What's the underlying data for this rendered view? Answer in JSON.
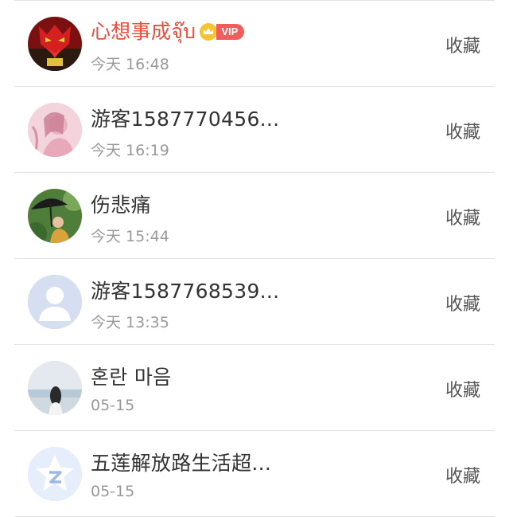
{
  "items": [
    {
      "name": "心想事成จุ๊บ",
      "time": "今天 16:48",
      "action": "收藏",
      "vip": true,
      "vip_label": "VIP",
      "avatar": "red-mask"
    },
    {
      "name": "游客1587770456...",
      "time": "今天 16:19",
      "action": "收藏",
      "vip": false,
      "avatar": "pink-girl"
    },
    {
      "name": "伤悲痛",
      "time": "今天 15:44",
      "action": "收藏",
      "vip": false,
      "avatar": "umbrella-girl"
    },
    {
      "name": "游客1587768539...",
      "time": "今天 13:35",
      "action": "收藏",
      "vip": false,
      "avatar": "default-person"
    },
    {
      "name": "혼란 마음",
      "time": "05-15",
      "action": "收藏",
      "vip": false,
      "avatar": "sea-girl"
    },
    {
      "name": "五莲解放路生活超...",
      "time": "05-15",
      "action": "收藏",
      "vip": false,
      "avatar": "qzone-star"
    }
  ],
  "colors": {
    "vip_name": "#f04b3c",
    "name": "#333333",
    "time": "#999999",
    "action": "#555555",
    "divider": "#e4e4e4",
    "vip_badge": "#f25c5c"
  }
}
